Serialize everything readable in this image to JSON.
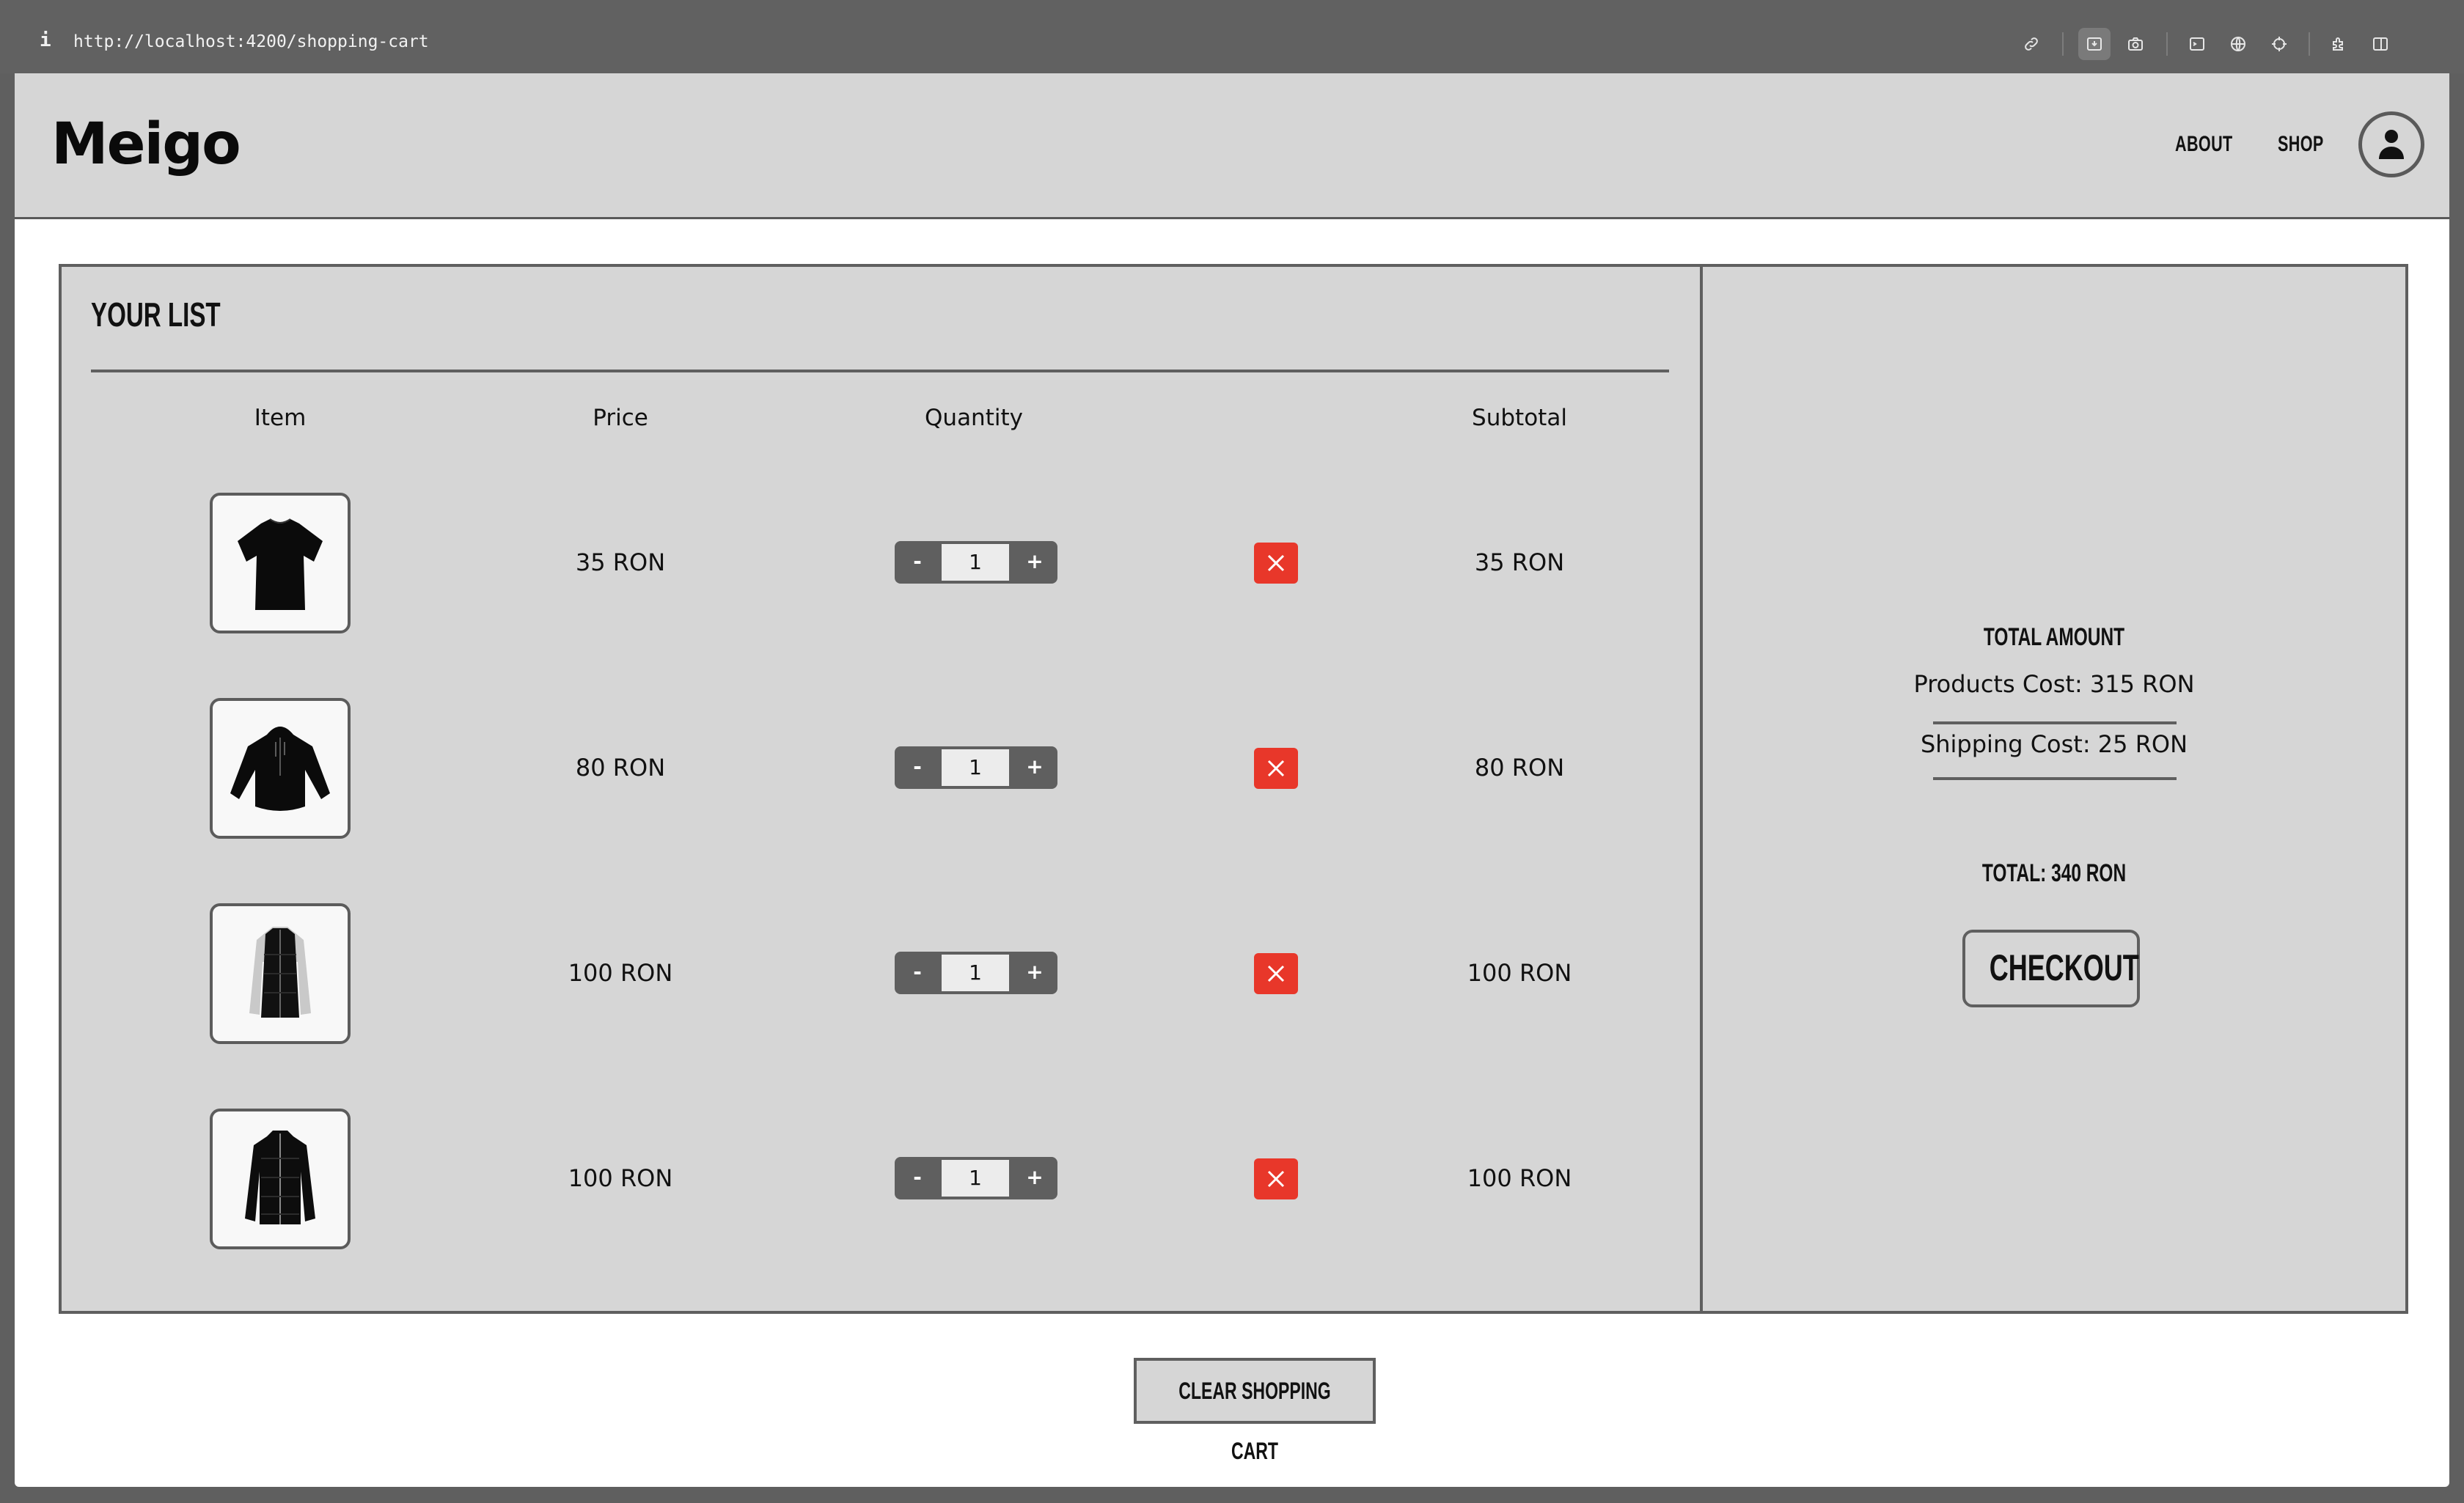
{
  "browser": {
    "info_icon": "info-icon",
    "url": "http://localhost:4200/shopping-cart",
    "toolbar_icons": [
      "link-icon",
      "save-page-icon",
      "camera-icon",
      "terminal-icon",
      "globe-icon",
      "crosshair-icon",
      "extensions-icon",
      "sidebar-icon"
    ]
  },
  "header": {
    "logo": "Meigo",
    "nav": [
      "ABOUT",
      "SHOP"
    ],
    "account_icon": "user-icon"
  },
  "cart": {
    "title": "YOUR LIST",
    "columns": [
      "Item",
      "Price",
      "Quantity",
      "Subtotal"
    ],
    "items": [
      {
        "image": "black-tshirt",
        "price": "35 RON",
        "quantity": "1",
        "subtotal": "35 RON",
        "minus": "-",
        "plus": "+"
      },
      {
        "image": "black-hoodie",
        "price": "80 RON",
        "quantity": "1",
        "subtotal": "80 RON",
        "minus": "-",
        "plus": "+"
      },
      {
        "image": "black-vest-jacket",
        "price": "100 RON",
        "quantity": "1",
        "subtotal": "100 RON",
        "minus": "-",
        "plus": "+"
      },
      {
        "image": "black-quilted-jacket",
        "price": "100 RON",
        "quantity": "1",
        "subtotal": "100 RON",
        "minus": "-",
        "plus": "+"
      }
    ],
    "remove_icon": "close-icon"
  },
  "summary": {
    "title": "TOTAL AMOUNT",
    "products_cost": "Products Cost: 315 RON",
    "shipping_cost": "Shipping Cost: 25 RON",
    "total": "TOTAL: 340 RON",
    "checkout_label": "CHECKOUT"
  },
  "actions": {
    "clear_label": "CLEAR SHOPPING CART"
  },
  "colors": {
    "panel": "#d6d6d6",
    "border": "#5f5f5f",
    "remove": "#e8372a"
  }
}
